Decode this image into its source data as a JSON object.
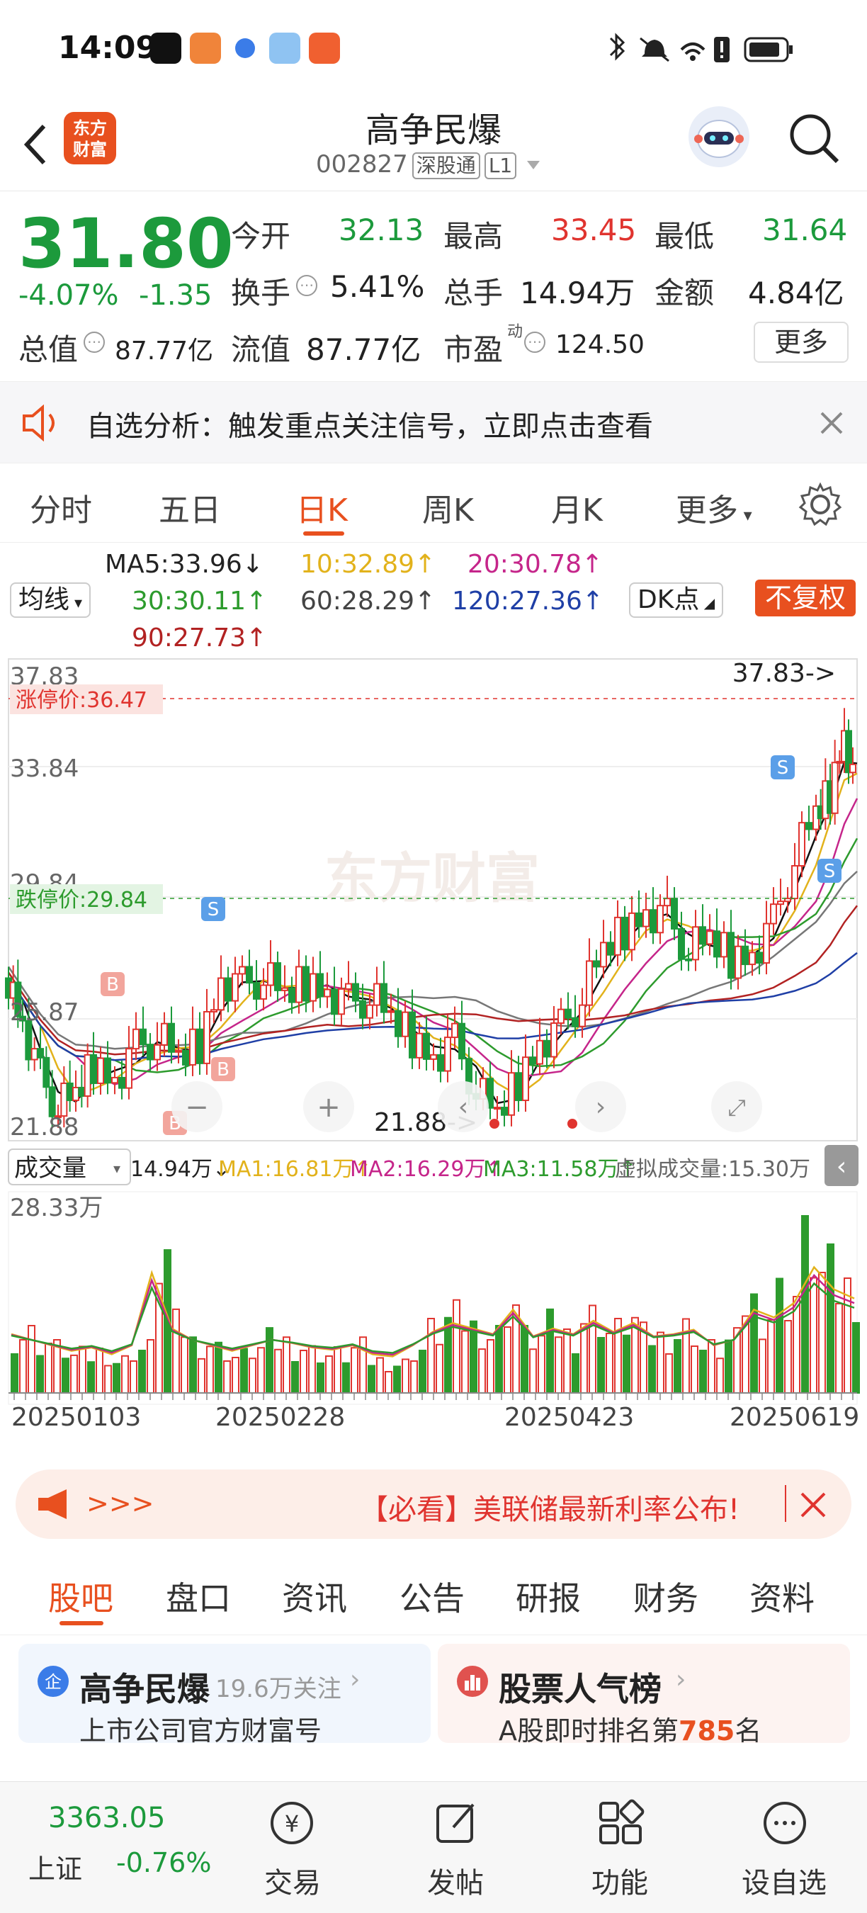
{
  "status_bar": {
    "time": "14:09"
  },
  "header": {
    "logo_text_line1": "东方",
    "logo_text_line2": "财富",
    "title": "高争民爆",
    "code": "002827",
    "tag1": "深股通",
    "tag2": "L1"
  },
  "quote": {
    "price": "31.80",
    "change_pct": "-4.07%",
    "change": "-1.35",
    "open_label": "今开",
    "open": "32.13",
    "high_label": "最高",
    "high": "33.45",
    "low_label": "最低",
    "low": "31.64",
    "turnover_label": "换手",
    "turnover": "5.41%",
    "volume_label": "总手",
    "volume": "14.94万",
    "amount_label": "金额",
    "amount": "4.84亿",
    "mktcap_label": "总值",
    "mktcap": "87.77亿",
    "float_label": "流值",
    "float": "87.77亿",
    "pe_label": "市盈",
    "pe_sup": "动",
    "pe": "124.50",
    "more": "更多"
  },
  "notice": {
    "text": "自选分析：触发重点关注信号，立即点击查看"
  },
  "tabs": [
    "分时",
    "五日",
    "日K",
    "周K",
    "月K",
    "更多"
  ],
  "active_tab": 2,
  "ma": {
    "selector": "均线",
    "ma5": "MA5:33.96↓",
    "ma10": "10:32.89↑",
    "ma20": "20:30.78↑",
    "ma30": "30:30.11↑",
    "ma60": "60:28.29↑",
    "ma120": "120:27.36↑",
    "ma90": "90:27.73↑",
    "dk": "DK点",
    "fq": "不复权"
  },
  "chart": {
    "y_top": "37.83",
    "y_2": "33.84",
    "y_3": "29.84",
    "y_4": "25.87",
    "y_bottom": "21.88",
    "limit_up": "涨停价:36.47",
    "limit_down": "跌停价:29.84",
    "max_note": "37.83->",
    "min_note": "21.88->",
    "watermark": "东方财富"
  },
  "volume": {
    "selector": "成交量",
    "v": "14.94万↓",
    "ma1": "MA1:16.81万↑",
    "ma2": "MA2:16.29万↑",
    "ma3": "MA3:11.58万↑",
    "virtual": "虚拟成交量:15.30万",
    "ymax": "28.33万",
    "dates": [
      "20250103",
      "20250228",
      "20250423",
      "20250619"
    ]
  },
  "banner": {
    "arrows": ">>>",
    "text": "【必看】美联储最新利率公布!"
  },
  "bottom_tabs": [
    "股吧",
    "盘口",
    "资讯",
    "公告",
    "研报",
    "财务",
    "资料"
  ],
  "cards": {
    "c1_title": "高争民爆",
    "c1_meta": "19.6万关注",
    "c1_sub": "上市公司官方财富号",
    "c2_title": "股票人气榜",
    "c2_sub_prefix": "A股即时排名第",
    "c2_rank": "785",
    "c2_sub_suffix": "名"
  },
  "bottom_nav": {
    "index_value": "3363.05",
    "index_name": "上证",
    "index_change": "-0.76%",
    "trade": "交易",
    "post": "发帖",
    "func": "功能",
    "watch": "设自选"
  },
  "colors": {
    "up": "#e0342f",
    "down": "#1c9a3c",
    "accent": "#e8501f"
  }
}
